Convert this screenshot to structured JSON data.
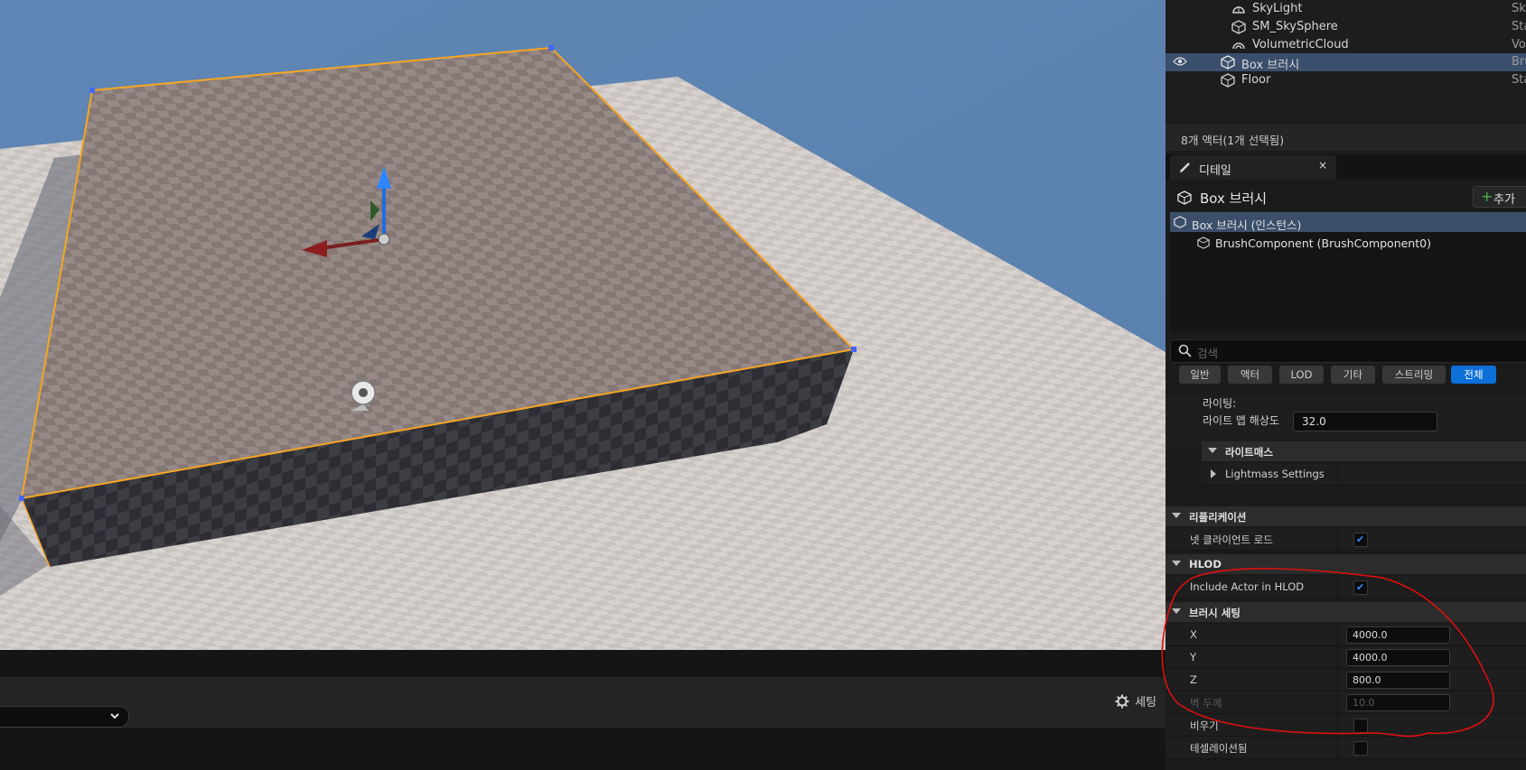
{
  "outliner": {
    "items": [
      {
        "label": "SkyLight",
        "type": "Sky",
        "icon": "skylight-icon"
      },
      {
        "label": "SM_SkySphere",
        "type": "Sta",
        "icon": "static-mesh-icon"
      },
      {
        "label": "VolumetricCloud",
        "type": "Vo",
        "icon": "cloud-icon"
      },
      {
        "label": "Box 브러시",
        "type": "Bru",
        "icon": "brush-icon",
        "selected": true
      },
      {
        "label": "Floor",
        "type": "Sta",
        "icon": "static-mesh-icon"
      }
    ],
    "status": "8개 액터(1개 선택됨)"
  },
  "details": {
    "tab_label": "디테일",
    "tab_close": "×",
    "title": "Box 브러시",
    "add_label": "추가",
    "components": [
      {
        "label": "Box 브러시 (인스턴스)",
        "selected": true
      },
      {
        "label": "BrushComponent (BrushComponent0)"
      }
    ],
    "search_placeholder": "검색",
    "filters": [
      "일반",
      "액터",
      "LOD",
      "기타",
      "스트리밍",
      "전체"
    ],
    "active_filter": "전체",
    "lighting_label": "라이팅:",
    "lightmap_label": "라이트 맵 해상도",
    "lightmap_value": "32.0",
    "lightmass_section": "라이트매스",
    "lightmass_settings": "Lightmass Settings",
    "replication_section": "리플리케이션",
    "net_load_label": "넷 클라이언트 로드",
    "net_load_checked": true,
    "hlod_section": "HLOD",
    "include_hlod_label": "Include Actor in HLOD",
    "include_hlod_checked": true,
    "brush_section": "브러시 세팅",
    "x_label": "X",
    "x_value": "4000.0",
    "y_label": "Y",
    "y_value": "4000.0",
    "z_label": "Z",
    "z_value": "800.0",
    "wall_label": "벽 두께",
    "wall_value": "10.0",
    "hollow_label": "비우기",
    "hollow_checked": false,
    "tess_label": "테셀레이션됨",
    "tess_checked": false
  },
  "bottom": {
    "settings_label": "세팅"
  },
  "colors": {
    "selection_outline": "#f5a623",
    "sky": "#5b84b3",
    "annotation": "#e01010",
    "accent": "#0c70d8"
  }
}
